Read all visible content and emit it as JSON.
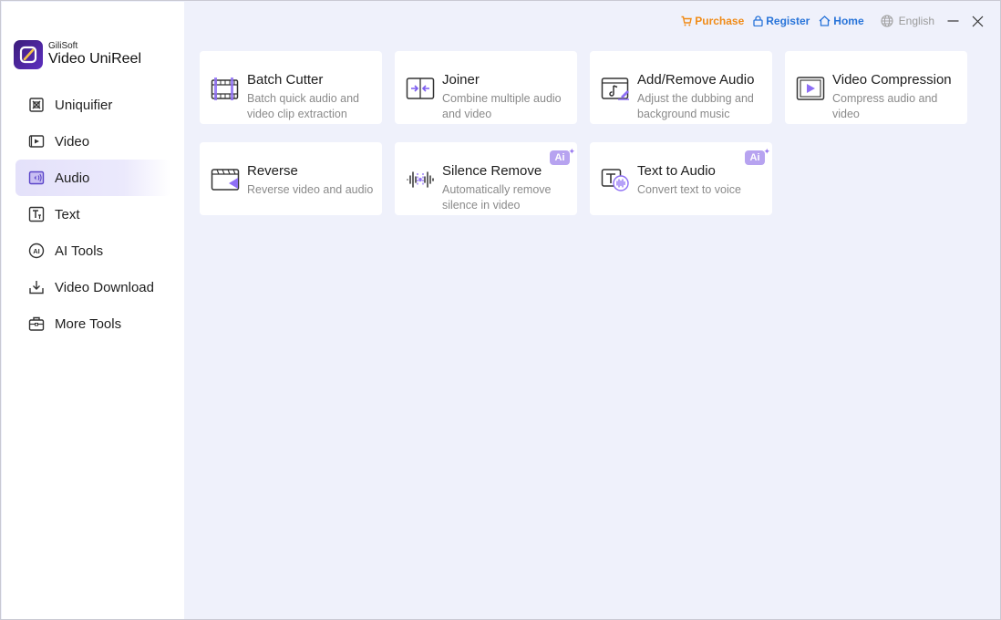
{
  "app": {
    "brand": "GiliSoft",
    "name": "Video UniReel"
  },
  "topbar": {
    "purchase": "Purchase",
    "register": "Register",
    "home": "Home",
    "language": "English"
  },
  "sidebar": {
    "items": [
      {
        "label": "Uniquifier",
        "icon": "uniquifier-icon"
      },
      {
        "label": "Video",
        "icon": "video-icon"
      },
      {
        "label": "Audio",
        "icon": "audio-icon",
        "active": true
      },
      {
        "label": "Text",
        "icon": "text-icon"
      },
      {
        "label": "AI Tools",
        "icon": "ai-icon"
      },
      {
        "label": "Video Download",
        "icon": "download-icon"
      },
      {
        "label": "More Tools",
        "icon": "toolbox-icon"
      }
    ]
  },
  "cards": [
    {
      "title": "Batch Cutter",
      "desc": "Batch quick audio and video clip extraction",
      "icon": "film-cut-icon",
      "ai": false
    },
    {
      "title": "Joiner",
      "desc": "Combine multiple audio and video",
      "icon": "join-icon",
      "ai": false
    },
    {
      "title": "Add/Remove Audio",
      "desc": "Adjust the dubbing and background music",
      "icon": "music-edit-icon",
      "ai": false
    },
    {
      "title": "Video Compression",
      "desc": "Compress audio and video",
      "icon": "compress-icon",
      "ai": false
    },
    {
      "title": "Reverse",
      "desc": "Reverse video and audio",
      "icon": "reverse-icon",
      "ai": false
    },
    {
      "title": "Silence Remove",
      "desc": "Automatically remove silence in video",
      "icon": "waveform-icon",
      "ai": true,
      "badge": "Ai"
    },
    {
      "title": "Text to Audio",
      "desc": "Convert text to voice",
      "icon": "text-voice-icon",
      "ai": true,
      "badge": "Ai"
    }
  ],
  "colors": {
    "accent": "#7c5cf0",
    "purchase": "#f08b17",
    "link": "#2874d9",
    "background": "#eff1fb"
  }
}
